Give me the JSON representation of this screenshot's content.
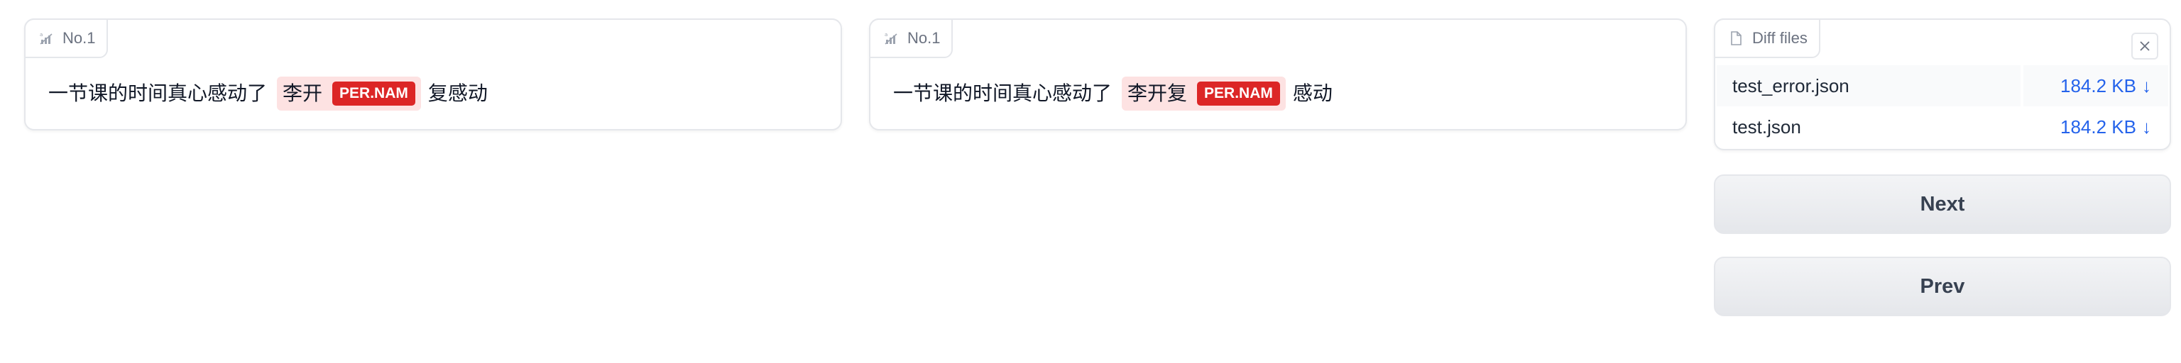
{
  "panels": [
    {
      "label": "No.1",
      "text_before": "一节课的时间真心感动了",
      "entity_text": "李开",
      "entity_tag": "PER.NAM",
      "text_after": "复感动"
    },
    {
      "label": "No.1",
      "text_before": "一节课的时间真心感动了",
      "entity_text": "李开复",
      "entity_tag": "PER.NAM",
      "text_after": "感动"
    }
  ],
  "files": {
    "label": "Diff files",
    "items": [
      {
        "name": "test_error.json",
        "size": "184.2 KB"
      },
      {
        "name": "test.json",
        "size": "184.2 KB"
      }
    ]
  },
  "buttons": {
    "next": "Next",
    "prev": "Prev"
  },
  "colors": {
    "entity_bg": "#fde2e2",
    "entity_tag": "#dc2626",
    "link": "#2563eb"
  }
}
